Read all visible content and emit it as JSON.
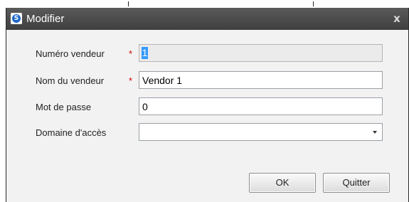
{
  "dialog": {
    "title": "Modifier",
    "app_icon": "app-logo-icon",
    "close_label": "x"
  },
  "form": {
    "vendor_number": {
      "label": "Numéro vendeur",
      "required_mark": "*",
      "value": "1"
    },
    "vendor_name": {
      "label": "Nom du vendeur",
      "required_mark": "*",
      "value": "Vendor 1"
    },
    "password": {
      "label": "Mot de passe",
      "value": "0"
    },
    "access_domain": {
      "label": "Domaine d'accès",
      "value": ""
    }
  },
  "buttons": {
    "ok_label": "OK",
    "quit_label": "Quitter"
  },
  "colors": {
    "titlebar": "#4a4a4a",
    "required": "#d00000",
    "selection": "#3399ff"
  }
}
